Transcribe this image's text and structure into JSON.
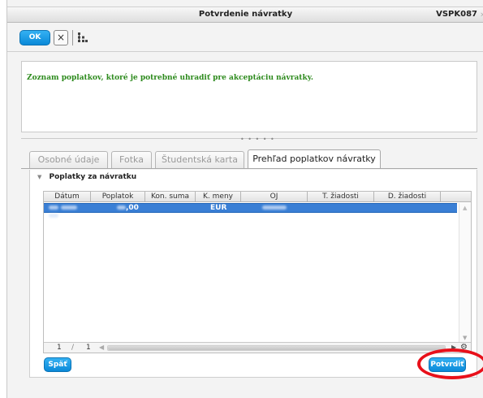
{
  "window": {
    "title": "Potvrdenie návratky",
    "code": "VSPK087"
  },
  "toolbar": {
    "ok_label": "OK",
    "close_label": "×",
    "tree_icon": "hierarchy-icon"
  },
  "message": "Zoznam poplatkov, ktoré je potrebné uhradiť pre akceptáciu návratky.",
  "tabs": [
    {
      "label": "Osobné údaje",
      "active": false
    },
    {
      "label": "Fotka",
      "active": false
    },
    {
      "label": "Študentská karta",
      "active": false
    },
    {
      "label": "Prehľad poplatkov návratky",
      "active": true
    }
  ],
  "section": {
    "title": "Poplatky za návratku"
  },
  "table": {
    "columns": [
      "Dátum",
      "Poplatok",
      "Kon. suma",
      "K. meny",
      "OJ",
      "T. žiadosti",
      "D. žiadosti"
    ],
    "rows": [
      {
        "datum": "",
        "poplatok": ",00",
        "kon_suma": "",
        "k_meny": "EUR",
        "oj": "",
        "t_ziadosti": "",
        "d_ziadosti": ""
      }
    ]
  },
  "pager": {
    "current": "1",
    "separator": "/",
    "total": "1"
  },
  "buttons": {
    "back_label": "Späť",
    "confirm_label": "Potvrdiť"
  },
  "colors": {
    "accent_blue": "#1a9be6",
    "selected_row": "#3a7fd5",
    "message_green": "#2e8b1e",
    "highlight_red": "#e8101a"
  }
}
